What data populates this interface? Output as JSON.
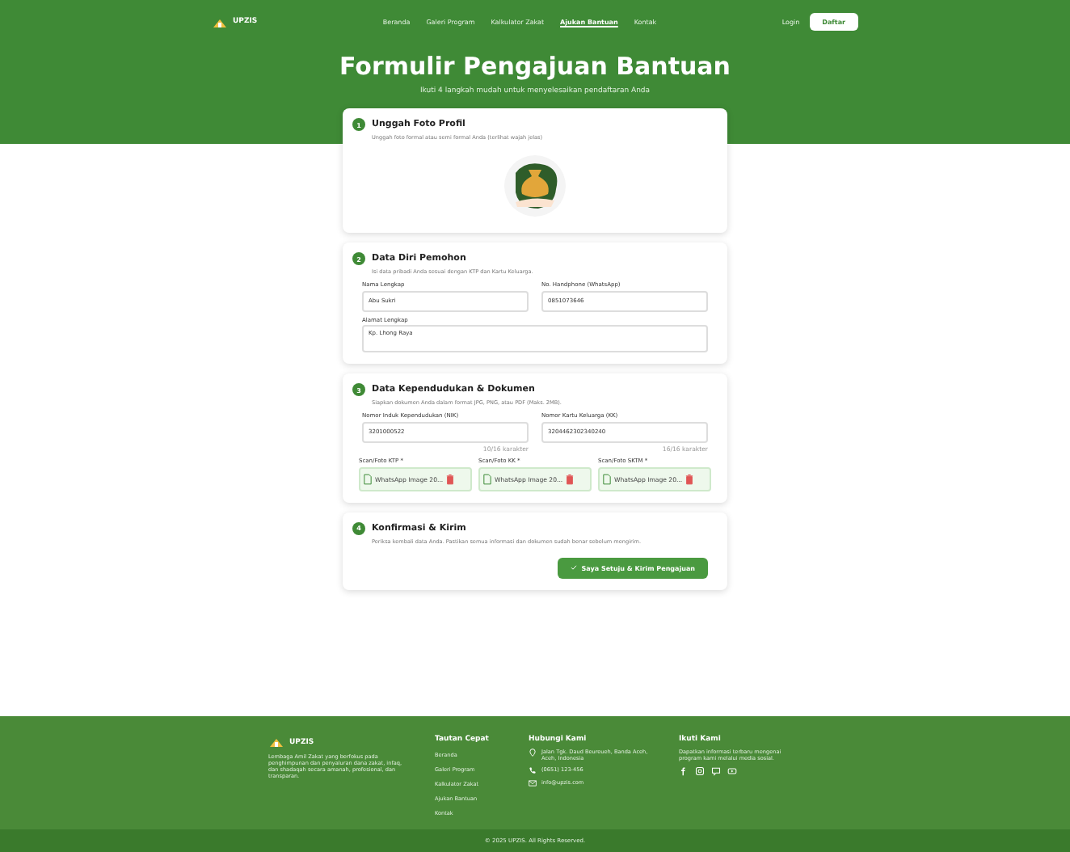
{
  "brand": "UPZIS",
  "nav": [
    {
      "label": "Beranda",
      "selected": false
    },
    {
      "label": "Galeri Program",
      "selected": false
    },
    {
      "label": "Kalkulator Zakat",
      "selected": false
    },
    {
      "label": "Ajukan Bantuan",
      "selected": true
    },
    {
      "label": "Kontak",
      "selected": false
    }
  ],
  "login": "Login",
  "register": "Daftar",
  "title": "Formulir Pengajuan Bantuan",
  "subtitle": "Ikuti 4 langkah mudah untuk menyelesaikan pendaftaran Anda",
  "steps": [
    {
      "number": "1",
      "title": "Unggah Foto Profil",
      "hint": "Unggah foto formal atau semi formal Anda (terlihat wajah jelas)"
    },
    {
      "number": "2",
      "title": "Data Diri Pemohon",
      "hint": "Isi data pribadi Anda sesuai dengan KTP dan Kartu Keluarga.",
      "fields": [
        {
          "label": "Nama Lengkap",
          "value": "Abu Sukri",
          "kind": "input"
        },
        {
          "label": "No. Handphone (WhatsApp)",
          "value": "0851073646",
          "kind": "input"
        },
        {
          "label": "Alamat Lengkap",
          "value": "Kp. Lhong Raya",
          "kind": "textarea"
        }
      ]
    },
    {
      "number": "3",
      "title": "Data Kependudukan & Dokumen",
      "hint": "Siapkan dokumen Anda dalam format JPG, PNG, atau PDF (Maks. 2MB).",
      "fields": [
        {
          "label": "Nomor Induk Kependudukan (NIK)",
          "value": "3201000522",
          "kind": "input",
          "counter": "10/16 karakter"
        },
        {
          "label": "Nomor Kartu Keluarga (KK)",
          "value": "3204462302340240",
          "kind": "input",
          "counter": "16/16 karakter"
        }
      ],
      "uploads": [
        {
          "label": "Scan/Foto KTP *",
          "file": "WhatsApp Image 20..."
        },
        {
          "label": "Scan/Foto KK *",
          "file": "WhatsApp Image 20..."
        },
        {
          "label": "Scan/Foto SKTM *",
          "file": "WhatsApp Image 20..."
        }
      ]
    },
    {
      "number": "4",
      "title": "Konfirmasi & Kirim",
      "hint": "Periksa kembali data Anda. Pastikan semua informasi dan dokumen sudah benar sebelum mengirim.",
      "submit": "Saya Setuju & Kirim Pengajuan"
    }
  ],
  "footer": {
    "brand": "UPZIS",
    "about": "Lembaga Amil Zakat yang berfokus pada penghimpunan dan penyaluran dana zakat, infaq, dan shadaqah secara amanah, profesional, dan transparan.",
    "links_title": "Tautan Cepat",
    "links": [
      "Beranda",
      "Galeri Program",
      "Kalkulator Zakat",
      "Ajukan Bantuan",
      "Kontak"
    ],
    "contact_title": "Hubungi Kami",
    "contacts": [
      {
        "kind": "address",
        "text": "Jalan Tgk. Daud Beureueh, Banda Aceh, Aceh, Indonesia"
      },
      {
        "kind": "phone",
        "text": "(0651) 123-456"
      },
      {
        "kind": "email",
        "text": "info@upzis.com"
      }
    ],
    "follow_title": "Ikuti Kami",
    "follow_text": "Dapatkan informasi terbaru mengenai program kami melalui media sosial.",
    "copyright": "© 2025 UPZIS. All Rights Reserved."
  }
}
